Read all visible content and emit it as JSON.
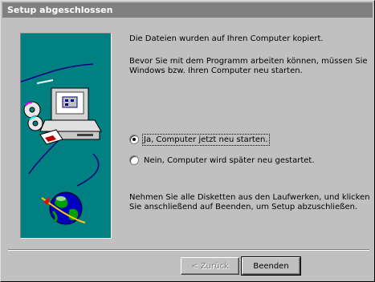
{
  "window": {
    "title": "Setup abgeschlossen"
  },
  "main": {
    "text1": "Die Dateien wurden auf Ihren Computer kopiert.",
    "text2": "Bevor Sie mit dem Programm arbeiten können, müssen Sie\nWindows bzw. Ihren Computer neu starten.",
    "options": [
      {
        "label": "Ja, Computer jetzt neu starten.",
        "selected": true
      },
      {
        "label": "Nein, Computer wird später neu gestartet.",
        "selected": false
      }
    ],
    "text3": "Nehmen Sie alle Disketten aus den Laufwerken, und klicken\nSie anschließend auf Beenden, um Setup abzuschließen."
  },
  "buttons": {
    "back": "< Zurück",
    "finish": "Beenden"
  },
  "colors": {
    "title_bar": "#808080",
    "art_background": "#008080",
    "face": "#c0c0c0"
  }
}
